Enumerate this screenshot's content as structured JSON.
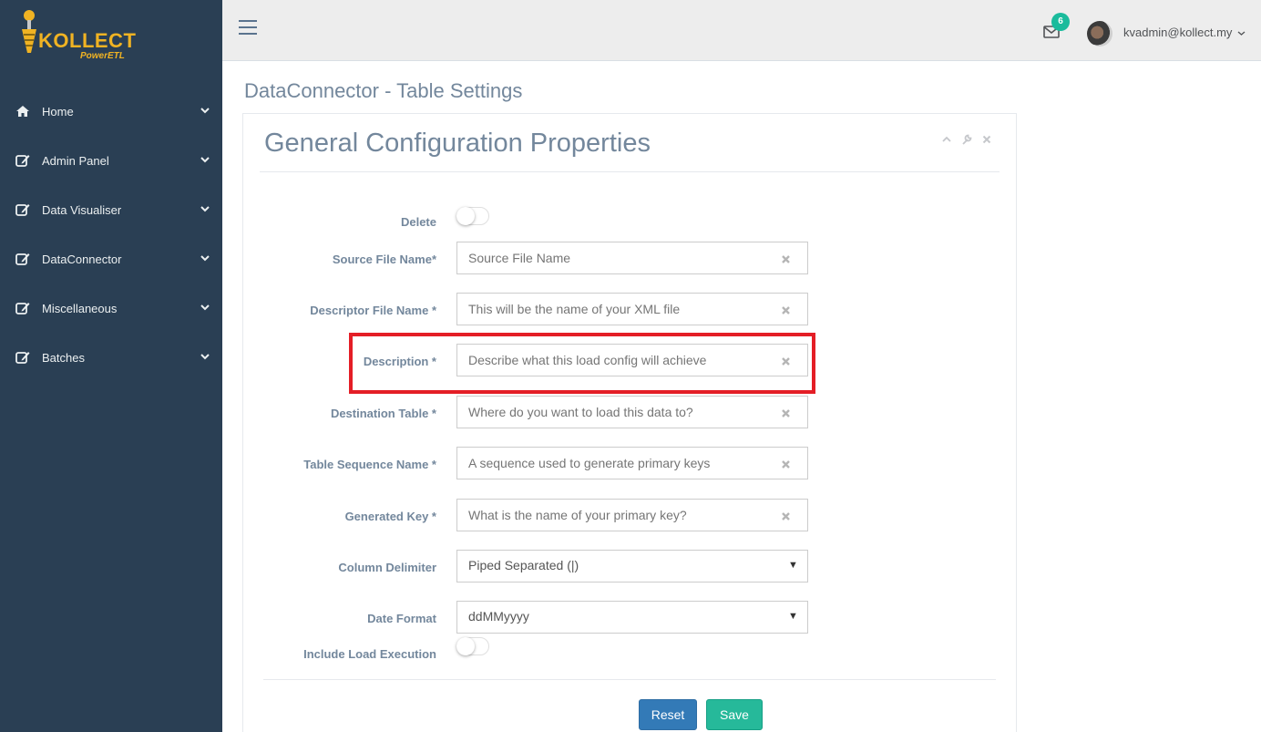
{
  "brand": {
    "name": "KOLLECT",
    "subtitle": "PowerETL"
  },
  "sidebar": {
    "items": [
      {
        "label": "Home",
        "icon": "home-icon"
      },
      {
        "label": "Admin Panel",
        "icon": "edit-icon"
      },
      {
        "label": "Data Visualiser",
        "icon": "edit-icon"
      },
      {
        "label": "DataConnector",
        "icon": "edit-icon"
      },
      {
        "label": "Miscellaneous",
        "icon": "edit-icon"
      },
      {
        "label": "Batches",
        "icon": "edit-icon"
      }
    ]
  },
  "topbar": {
    "notification_count": "6",
    "user": "kvadmin@kollect.my"
  },
  "page": {
    "title": "DataConnector - Table Settings"
  },
  "panel": {
    "title": "General Configuration Properties",
    "form": {
      "delete_label": "Delete",
      "source_file_label": "Source File Name*",
      "source_file_placeholder": "Source File Name",
      "descriptor_label": "Descriptor File Name *",
      "descriptor_placeholder": "This will be the name of your XML file",
      "description_label": "Description *",
      "description_placeholder": "Describe what this load config will achieve",
      "destination_label": "Destination Table *",
      "destination_placeholder": "Where do you want to load this data to?",
      "sequence_label": "Table Sequence Name *",
      "sequence_placeholder": "A sequence used to generate primary keys",
      "generated_key_label": "Generated Key *",
      "generated_key_placeholder": "What is the name of your primary key?",
      "column_delimiter_label": "Column Delimiter",
      "column_delimiter_value": "Piped Separated (|)",
      "date_format_label": "Date Format",
      "date_format_value": "ddMMyyyy",
      "include_load_label": "Include Load Execution"
    },
    "buttons": {
      "reset": "Reset",
      "save": "Save"
    }
  },
  "colors": {
    "sidebar_bg": "#2a3f54",
    "brand": "#f0b323",
    "badge": "#1abb9c",
    "reset_btn": "#337ab7",
    "save_btn": "#26b99a",
    "highlight": "#e41e26"
  }
}
